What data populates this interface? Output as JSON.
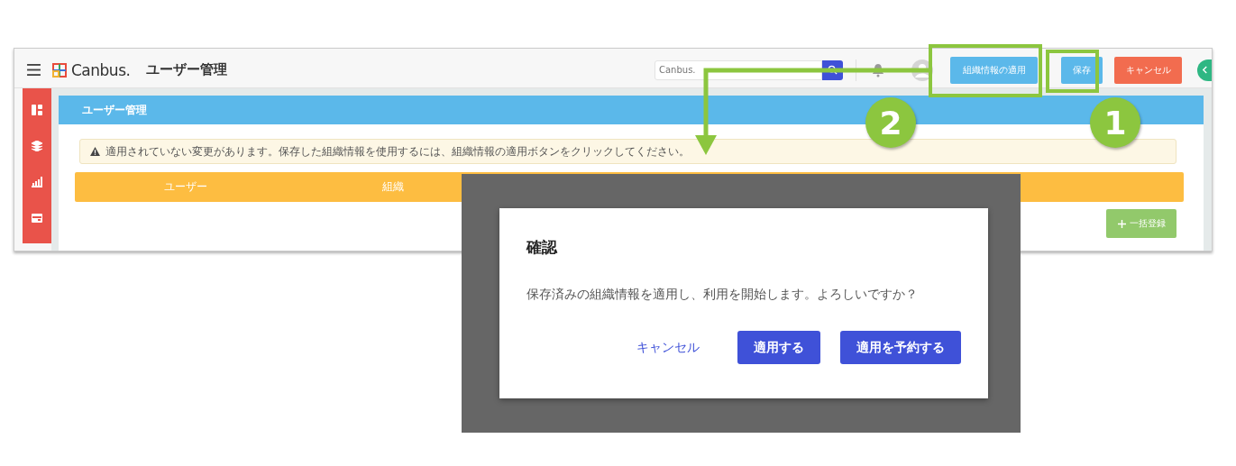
{
  "topbar": {
    "logo_text": "Canbus.",
    "page_title": "ユーザー管理",
    "search": {
      "placeholder": "Canbus."
    },
    "buttons": [
      {
        "label": "組織情報の適用",
        "kind": "apply"
      },
      {
        "label": "保存",
        "kind": "save"
      },
      {
        "label": "キャンセル",
        "kind": "cancel"
      }
    ]
  },
  "panel": {
    "title": "ユーザー管理",
    "alert": "適用されていない変更があります。保存した組織情報を使用するには、組織情報の適用ボタンをクリックしてください。",
    "table": {
      "columns": [
        "ユーザー",
        "組織"
      ]
    },
    "bulk_button": "一括登録"
  },
  "dialog": {
    "title": "確認",
    "message": "保存済みの組織情報を適用し、利用を開始します。よろしいですか？",
    "buttons": [
      {
        "label": "キャンセル",
        "kind": "text"
      },
      {
        "label": "適用する",
        "kind": "primary"
      },
      {
        "label": "適用を予約する",
        "kind": "primary"
      }
    ]
  },
  "callouts": [
    {
      "number": "2"
    },
    {
      "number": "1"
    }
  ]
}
